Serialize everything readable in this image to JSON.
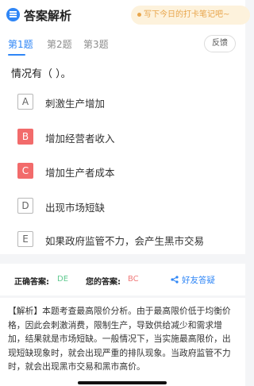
{
  "header": {
    "title": "答案解析",
    "banner": "写下今日的打卡笔记吧~"
  },
  "tabs": [
    {
      "label": "第1题",
      "active": true
    },
    {
      "label": "第2题",
      "active": false
    },
    {
      "label": "第3题",
      "active": false
    }
  ],
  "feedback_label": "反馈",
  "question": {
    "stem": "情况有（    ）。",
    "options": [
      {
        "letter": "A",
        "text": "刺激生产增加",
        "state": "normal"
      },
      {
        "letter": "B",
        "text": "增加经营者收入",
        "state": "wrong"
      },
      {
        "letter": "C",
        "text": "增加生产者成本",
        "state": "wrong"
      },
      {
        "letter": "D",
        "text": "出现市场短缺",
        "state": "normal"
      },
      {
        "letter": "E",
        "text": "如果政府监管不力，会产生黑市交易",
        "state": "normal"
      }
    ]
  },
  "result": {
    "correct_label": "正确答案:",
    "correct_value": "DE",
    "yours_label": "您的答案:",
    "yours_value": "BC",
    "ask_friend": "好友答疑"
  },
  "analysis": {
    "text": "【解析】本题考查最高限价分析。由于最高限价低于均衡价格，因此会刺激消费，限制生产，导致供给减少和需求增加，结果就是市场短缺。一般情况下，当实施最高限价，出现短缺现象时，就会出现严重的排队现象。当政府监管不力时，就会出现黑市交易和黑市高价。"
  },
  "colors": {
    "accent": "#2f86f6",
    "wrong": "#f26b6b",
    "correct_text": "#5fc98f",
    "your_answer_text": "#f07a7a",
    "banner_bg": "#fdf2dc",
    "banner_text": "#e8a54b"
  }
}
